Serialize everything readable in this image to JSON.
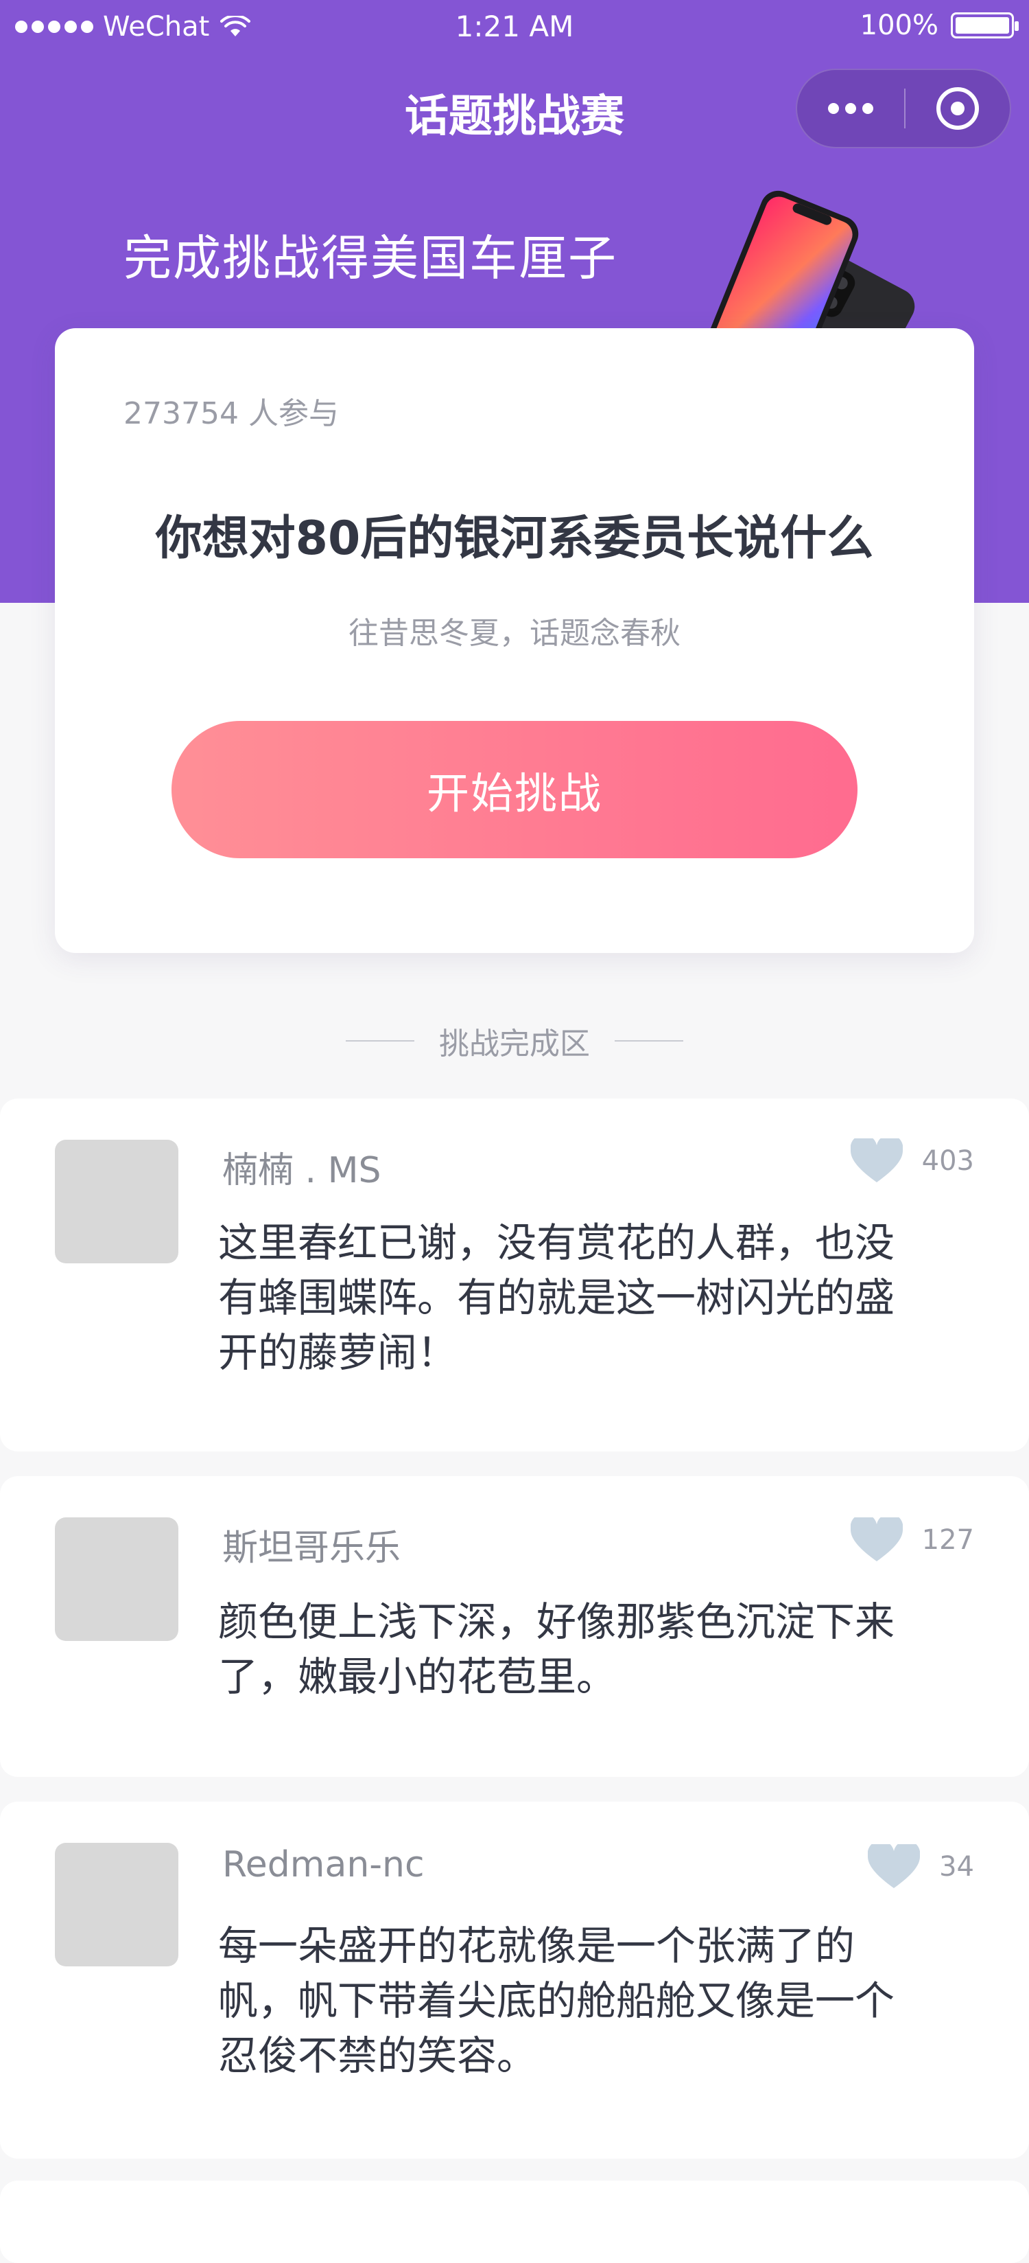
{
  "status_bar": {
    "carrier": "WeChat",
    "time": "1:21 AM",
    "battery": "100%"
  },
  "nav": {
    "title": "话题挑战赛"
  },
  "banner": {
    "text": "完成挑战得美国车厘子"
  },
  "topic": {
    "participants": "273754 人参与",
    "title": "你想对80后的银河系委员长说什么",
    "subtitle": "往昔思冬夏，话题念春秋",
    "start_label": "开始挑战"
  },
  "section": {
    "label": "挑战完成区"
  },
  "comments": [
    {
      "user": "楠楠 . MS",
      "likes": "403",
      "lines": [
        "这里春红已谢，没有赏花的人群，也没",
        "有蜂围蝶阵。有的就是这一树闪光的盛",
        "开的藤萝闹！"
      ]
    },
    {
      "user": "斯坦哥乐乐",
      "likes": "127",
      "lines": [
        "颜色便上浅下深，好像那紫色沉淀下来",
        "了，嫩最小的花苞里。"
      ]
    },
    {
      "user": "Redman-nc",
      "likes": "34",
      "lines": [
        "每一朵盛开的花就像是一个张满了的",
        "帆，帆下带着尖底的舱船舱又像是一个",
        "忍俊不禁的笑容。"
      ]
    }
  ],
  "colors": {
    "header_bg": "#8455d4",
    "button_gradient_start": "#ff8f96",
    "button_gradient_end": "#ff6b8f",
    "heart": "#c8d6e2"
  }
}
